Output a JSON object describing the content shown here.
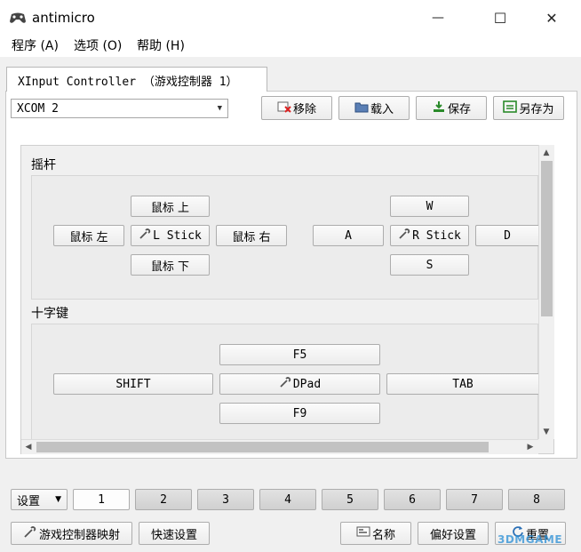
{
  "window": {
    "title": "antimicro",
    "icon": "gamepad-icon",
    "minimize": "—",
    "maximize": "☐",
    "close": "✕"
  },
  "menu": [
    "程序 (A)",
    "选项 (O)",
    "帮助 (H)"
  ],
  "tab": {
    "label": "XInput Controller （游戏控制器 1）"
  },
  "profile": {
    "selected": "XCOM 2"
  },
  "toolbar": {
    "remove": "移除",
    "load": "载入",
    "save": "保存",
    "save_as": "另存为"
  },
  "sticks": {
    "title": "摇杆",
    "left": {
      "up": "鼠标 上",
      "left": "鼠标 左",
      "center": "L Stick",
      "right": "鼠标 右",
      "down": "鼠标 下"
    },
    "right": {
      "up": "W",
      "left": "A",
      "center": "R Stick",
      "right": "D",
      "down": "S"
    }
  },
  "dpad": {
    "title": "十字键",
    "up": "F5",
    "left": "SHIFT",
    "center": "DPad",
    "right": "TAB",
    "down": "F9"
  },
  "sets": {
    "label": "设置",
    "items": [
      "1",
      "2",
      "3",
      "4",
      "5",
      "6",
      "7",
      "8"
    ],
    "active": "1"
  },
  "bottom": {
    "mapping": "游戏控制器映射",
    "quick": "快速设置",
    "names": "名称",
    "prefs": "偏好设置",
    "reset": "重置"
  },
  "watermark": "3DMGAME"
}
